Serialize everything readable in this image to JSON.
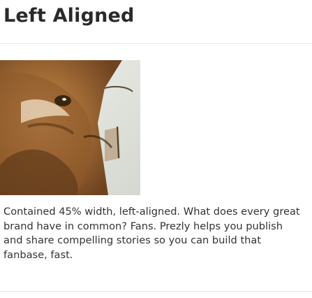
{
  "section": {
    "heading": "Left Aligned",
    "figure": {
      "icon": "photo-cat-face",
      "width_note": "45%"
    },
    "caption": "Contained 45% width, left-aligned. What does every great brand have in common? Fans. Prezly helps you publish and share compelling stories so you can build that fanbase, fast."
  },
  "colors": {
    "heading": "#2a2a2a",
    "text": "#333333",
    "divider": "#e6e6e6",
    "background": "#ffffff"
  }
}
